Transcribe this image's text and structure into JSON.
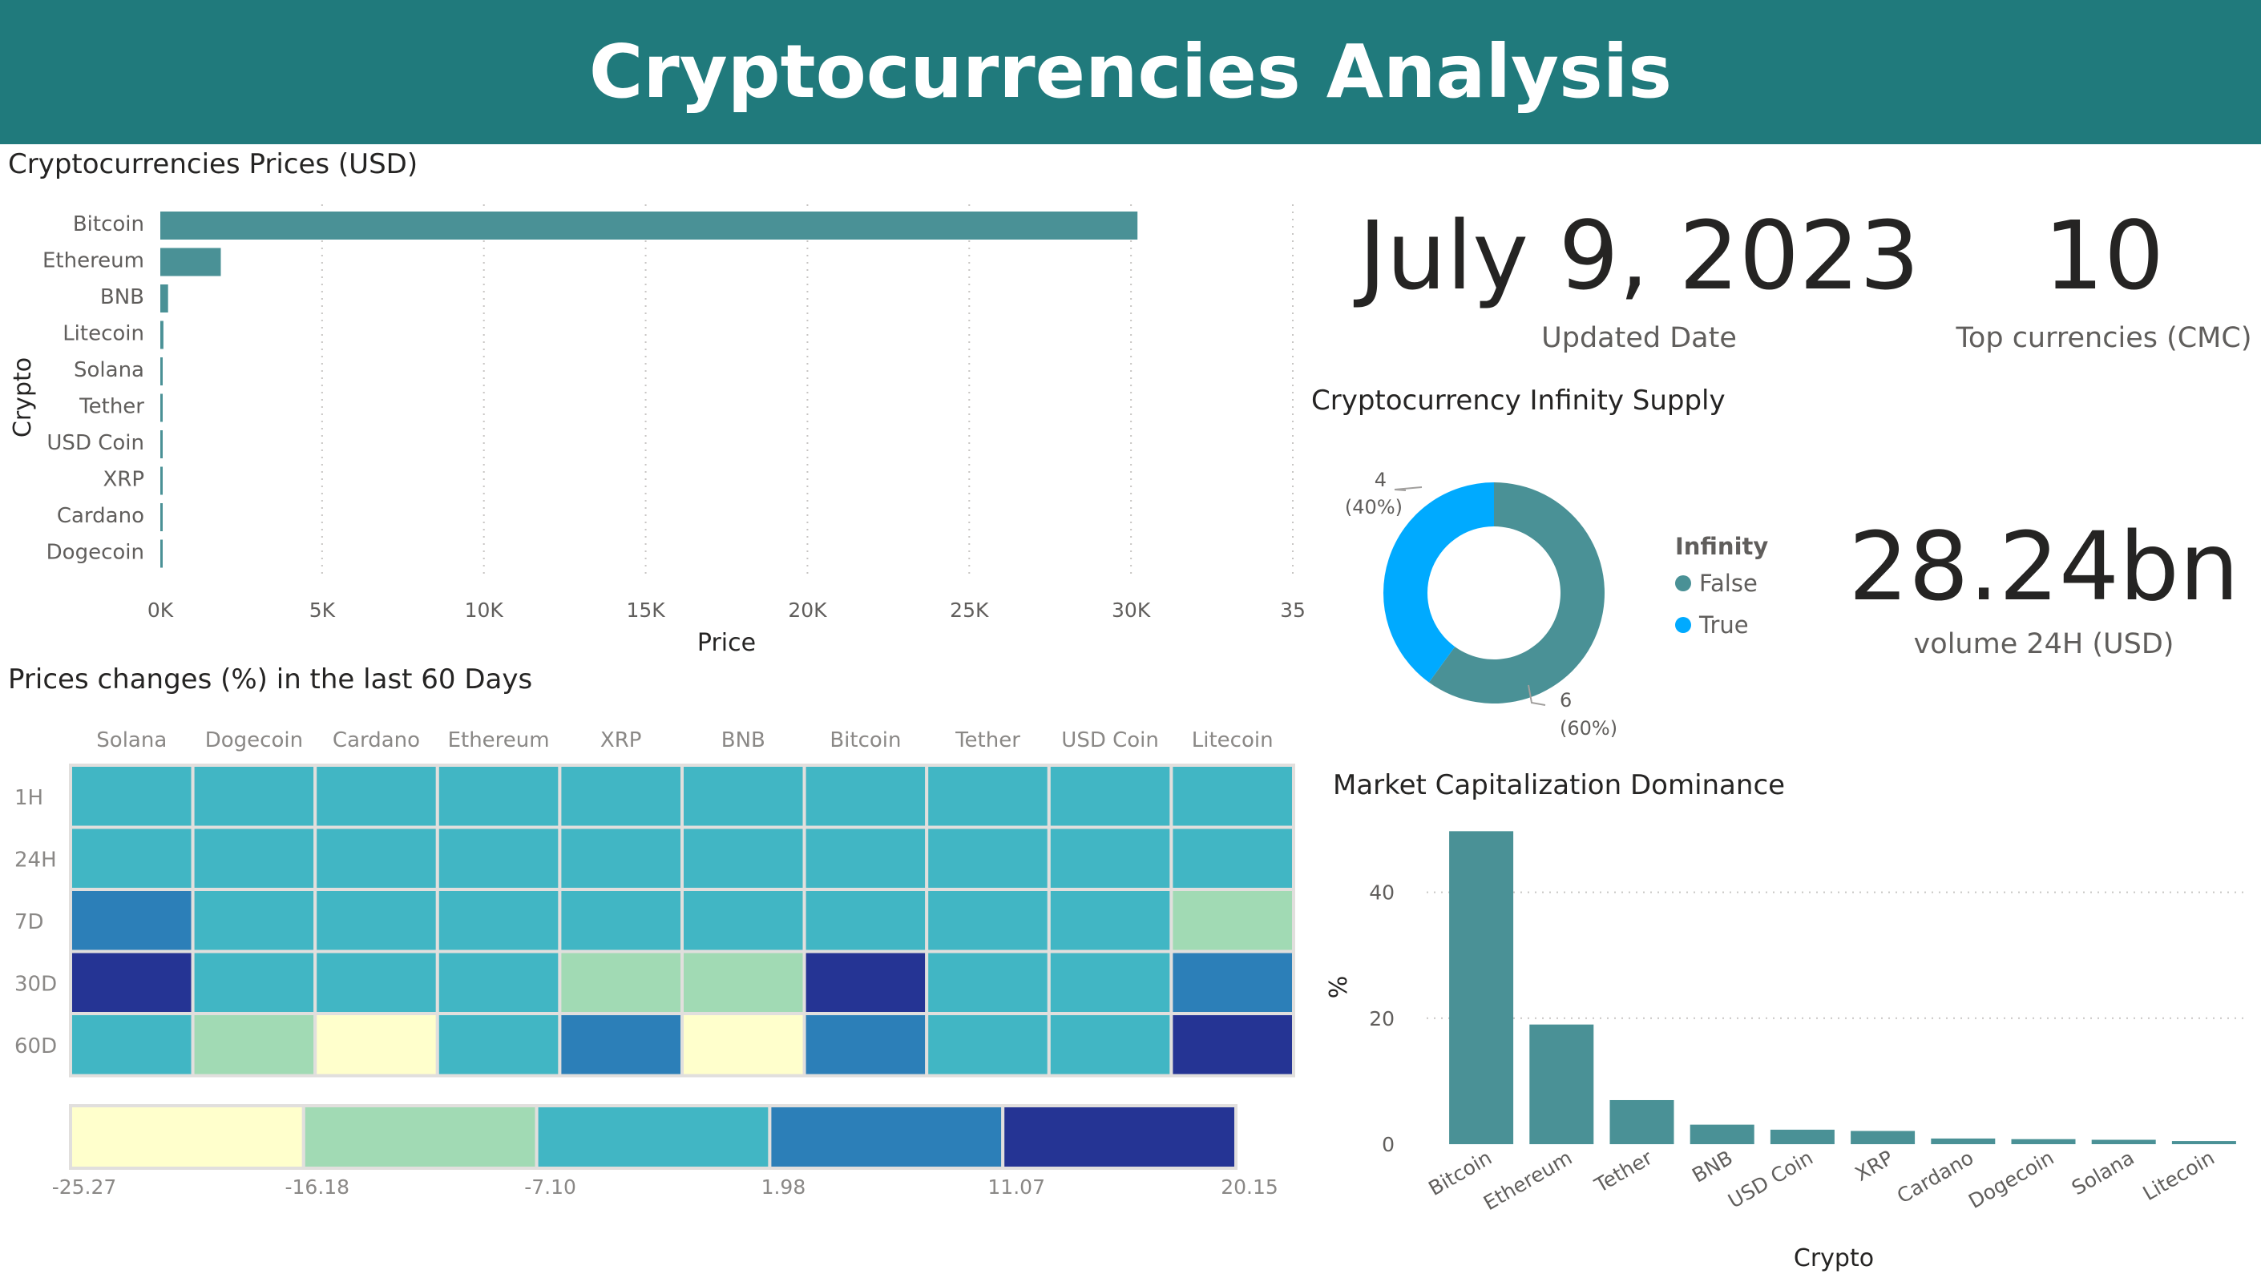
{
  "header": {
    "title": "Cryptocurrencies Analysis"
  },
  "prices_section": {
    "title": "Cryptocurrencies Prices (USD)"
  },
  "changes_section": {
    "title": "Prices changes (%) in the last 60 Days"
  },
  "supply_section": {
    "title": "Cryptocurrency Infinity Supply"
  },
  "dominance_section": {
    "title": "Market Capitalization Dominance"
  },
  "kpis": {
    "updated_date": {
      "value": "July 9, 2023",
      "label": "Updated Date"
    },
    "top_currencies": {
      "value": "10",
      "label": "Top currencies (CMC)"
    },
    "volume": {
      "value": "28.24bn",
      "label": "volume 24H (USD)"
    }
  },
  "colors": {
    "header": "#207a7c",
    "bar": "#4a9196",
    "donut_false": "#4a9196",
    "donut_true": "#00aaff"
  },
  "chart_data": [
    {
      "id": "prices",
      "type": "bar",
      "orientation": "horizontal",
      "categories": [
        "Bitcoin",
        "Ethereum",
        "BNB",
        "Litecoin",
        "Solana",
        "Tether",
        "USD Coin",
        "XRP",
        "Cardano",
        "Dogecoin"
      ],
      "values": [
        30200,
        1870,
        240,
        96,
        22,
        1,
        1,
        0.47,
        0.29,
        0.07
      ],
      "xlabel": "Price",
      "ylabel": "Crypto",
      "xlim": [
        0,
        35000
      ],
      "xticks": [
        "0K",
        "5K",
        "10K",
        "15K",
        "20K",
        "25K",
        "30K",
        "35"
      ],
      "grid": true
    },
    {
      "id": "changes",
      "type": "heatmap",
      "columns": [
        "Solana",
        "Dogecoin",
        "Cardano",
        "Ethereum",
        "XRP",
        "BNB",
        "Bitcoin",
        "Tether",
        "USD Coin",
        "Litecoin"
      ],
      "rows": [
        "1H",
        "24H",
        "7D",
        "30D",
        "60D"
      ],
      "values": [
        [
          -3,
          -3,
          -3,
          -3,
          -3,
          -3,
          -3,
          -3,
          -3,
          -3
        ],
        [
          -3,
          -3,
          -3,
          -3,
          -3,
          -3,
          -3,
          -3,
          -3,
          -3
        ],
        [
          6,
          -3,
          -3,
          -3,
          -3,
          -3,
          -3,
          -3,
          -3,
          -12
        ],
        [
          16,
          -3,
          -3,
          -3,
          -12,
          -12,
          16,
          -3,
          -3,
          6
        ],
        [
          -3,
          -12,
          -21,
          -3,
          6,
          -21,
          6,
          -3,
          -3,
          16
        ]
      ],
      "scale": {
        "breaks": [
          -25.27,
          -16.18,
          -7.1,
          1.98,
          11.07,
          20.15
        ],
        "labels": [
          "-25.27",
          "-16.18",
          "-7.10",
          "1.98",
          "11.07",
          "20.15"
        ],
        "colors": [
          "#ffffcc",
          "#a1dab4",
          "#41b6c4",
          "#2c7fb8",
          "#253494"
        ]
      }
    },
    {
      "id": "supply",
      "type": "pie",
      "legend_title": "Infinity",
      "legend_position": "right",
      "slices": [
        {
          "name": "False",
          "value": 6,
          "label": "6",
          "pct_label": "(60%)"
        },
        {
          "name": "True",
          "value": 4,
          "label": "4",
          "pct_label": "(40%)"
        }
      ]
    },
    {
      "id": "dominance",
      "type": "bar",
      "categories": [
        "Bitcoin",
        "Ethereum",
        "Tether",
        "BNB",
        "USD Coin",
        "XRP",
        "Cardano",
        "Dogecoin",
        "Solana",
        "Litecoin"
      ],
      "values": [
        49.7,
        19.0,
        7.0,
        3.1,
        2.3,
        2.1,
        0.9,
        0.8,
        0.7,
        0.5
      ],
      "xlabel": "Crypto",
      "ylabel": "%",
      "ylim": [
        0,
        50
      ],
      "yticks": [
        "0",
        "20",
        "40"
      ],
      "grid": true
    }
  ]
}
